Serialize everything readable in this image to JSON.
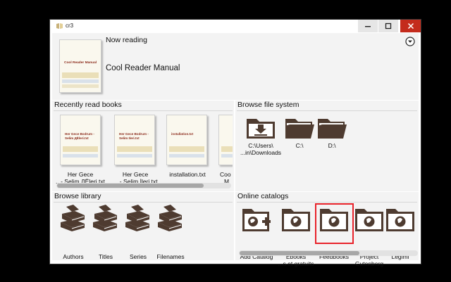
{
  "window": {
    "title": "cr3"
  },
  "now_reading": {
    "header": "Now reading",
    "book_title": "Cool Reader Manual",
    "cover_title": "Cool Reader Manual"
  },
  "recent": {
    "header": "Recently read books",
    "books": [
      {
        "cover": "Her Gece Bodrum - Selim ДЁleri.txt",
        "line1": "Her Gece",
        "line2": "...- Selim ДЁleri.txt"
      },
      {
        "cover": "Her Gece Bodrum - Selim Ileri.txt",
        "line1": "Her Gece",
        "line2": "... - Selim İleri.txt"
      },
      {
        "cover": "installation.txt",
        "line1": "installation.txt",
        "line2": ""
      },
      {
        "cover": "",
        "line1": "Coo",
        "line2": "M"
      }
    ]
  },
  "filesystem": {
    "header": "Browse file system",
    "items": [
      {
        "line1": "C:\\Users\\",
        "line2": "...in\\Downloads"
      },
      {
        "line1": "C:\\",
        "line2": ""
      },
      {
        "line1": "D:\\",
        "line2": ""
      }
    ]
  },
  "library": {
    "header": "Browse library",
    "items": [
      "Authors",
      "Titles",
      "Series",
      "Filenames"
    ]
  },
  "catalogs": {
    "header": "Online catalogs",
    "items": [
      {
        "line1": "Add Catalog",
        "line2": ""
      },
      {
        "line1": "Ebooks",
        "line2": "...s et gratuits"
      },
      {
        "line1": "Feedbooks",
        "line2": ""
      },
      {
        "line1": "Project",
        "line2": "Gutenberg"
      },
      {
        "line1": "Legimi",
        "line2": ""
      }
    ],
    "selected_index": 2,
    "selected_color": "#e8222a"
  },
  "colors": {
    "icon_brown": "#4e3b30",
    "panel_bg": "#f3f3f3"
  }
}
